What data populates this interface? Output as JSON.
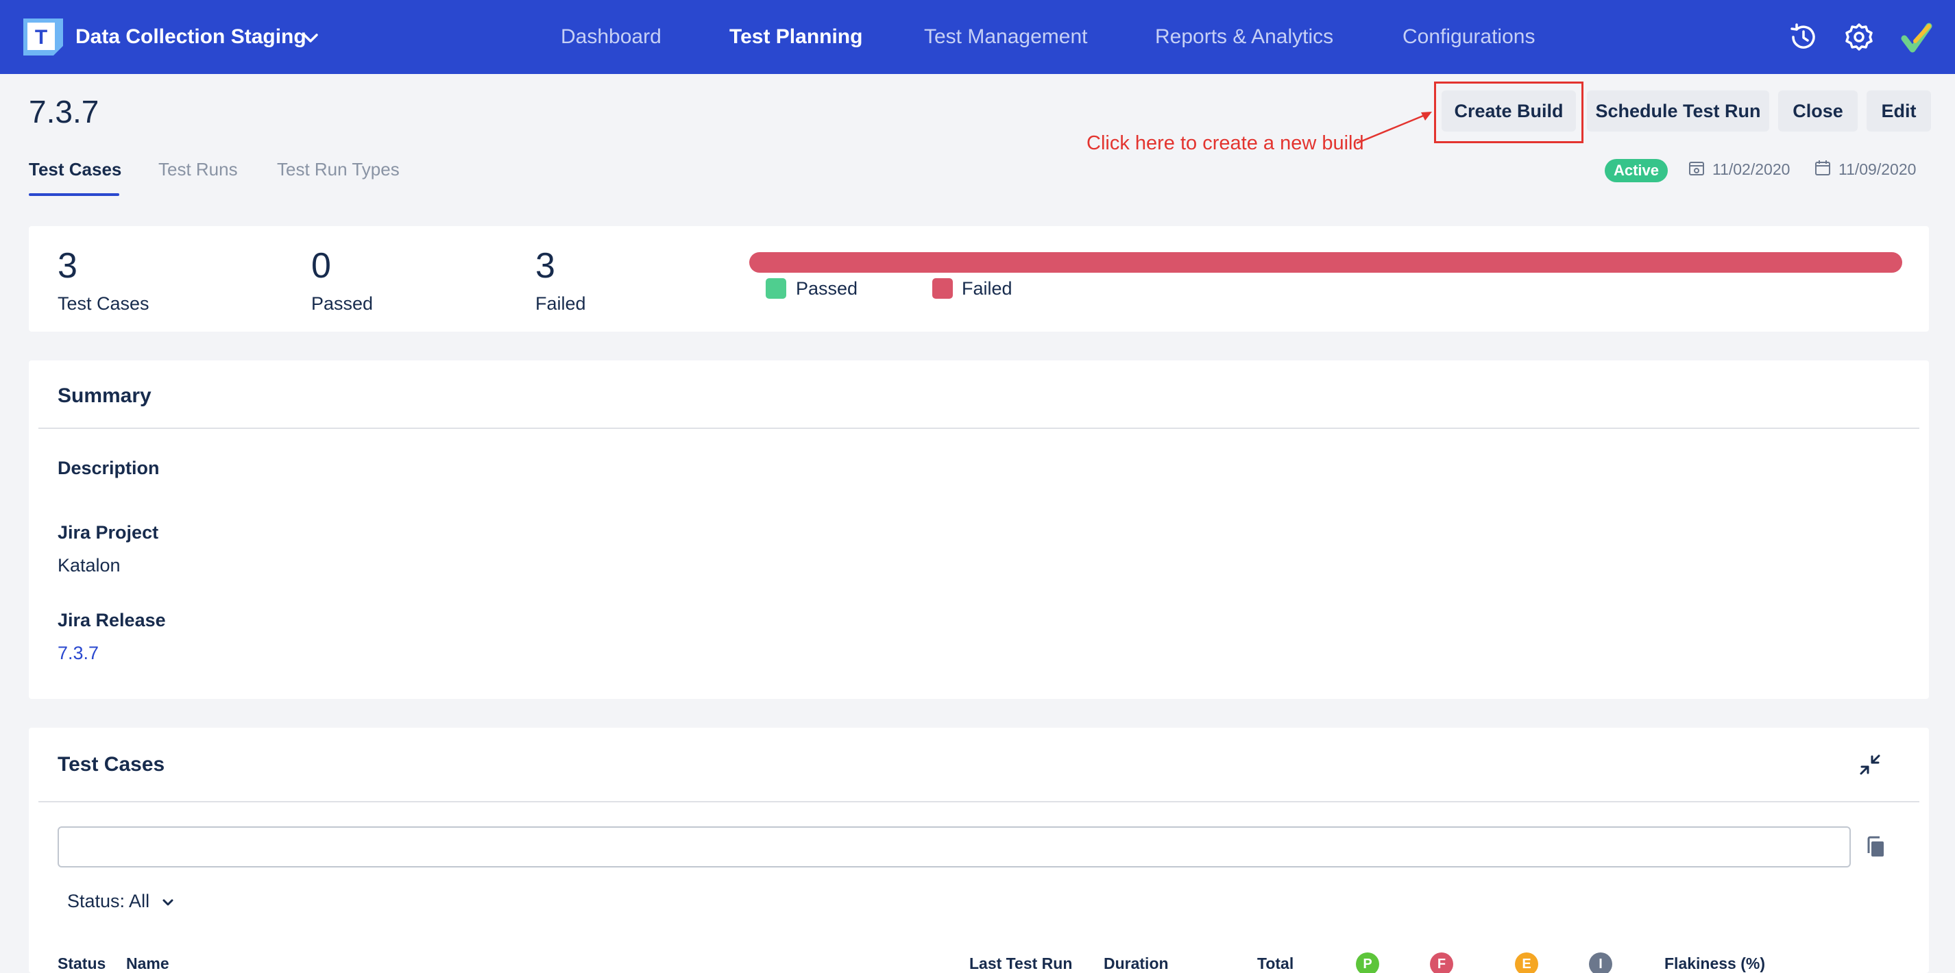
{
  "app": {
    "project_name": "Data Collection Staging",
    "logo_letter": "T"
  },
  "nav": {
    "items": [
      {
        "label": "Dashboard",
        "active": false
      },
      {
        "label": "Test Planning",
        "active": true
      },
      {
        "label": "Test Management",
        "active": false
      },
      {
        "label": "Reports & Analytics",
        "active": false
      },
      {
        "label": "Configurations",
        "active": false
      }
    ],
    "icons": [
      "history-icon",
      "settings-gear-icon",
      "katalon-brand-icon"
    ]
  },
  "build": {
    "title": "7.3.7",
    "status": "Active",
    "start_date": "11/02/2020",
    "end_date": "11/09/2020"
  },
  "tabs": [
    {
      "label": "Test Cases",
      "active": true
    },
    {
      "label": "Test Runs",
      "active": false
    },
    {
      "label": "Test Run Types",
      "active": false
    }
  ],
  "actions": {
    "create_build": "Create Build",
    "schedule_test_run": "Schedule Test Run",
    "close": "Close",
    "edit": "Edit"
  },
  "annotation": {
    "text": "Click here to create a new build"
  },
  "stats": {
    "test_cases": {
      "value": "3",
      "label": "Test Cases"
    },
    "passed": {
      "value": "0",
      "label": "Passed"
    },
    "failed": {
      "value": "3",
      "label": "Failed"
    },
    "passed_fraction": 0.0,
    "failed_fraction": 1.0,
    "legend": {
      "passed": "Passed",
      "failed": "Failed"
    },
    "colors": {
      "passed": "#4fce8f",
      "failed": "#d95469"
    }
  },
  "summary": {
    "title": "Summary",
    "description_label": "Description",
    "jira_project_label": "Jira Project",
    "jira_project_value": "Katalon",
    "jira_release_label": "Jira Release",
    "jira_release_value": "7.3.7"
  },
  "test_cases_section": {
    "title": "Test Cases",
    "search_value": "",
    "status_filter": "Status: All",
    "columns": {
      "status": "Status",
      "name": "Name",
      "last_test_run": "Last Test Run",
      "duration": "Duration",
      "total": "Total",
      "passed_short": "P",
      "failed_short": "F",
      "error_short": "E",
      "incomplete_short": "I",
      "flakiness": "Flakiness (%)"
    },
    "colors": {
      "passed": "#5dc53a",
      "failed": "#d95469",
      "error": "#f5a623",
      "incomplete": "#6b778c"
    }
  },
  "colors": {
    "nav_bg": "#2a48cf",
    "accent": "#2a48cf",
    "annotation": "#e3342f",
    "active_badge": "#36c48a"
  }
}
